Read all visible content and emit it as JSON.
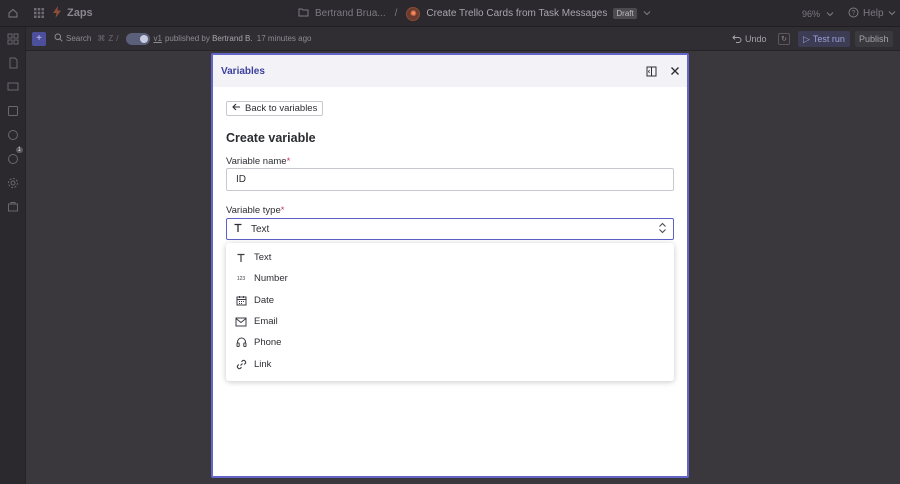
{
  "topbar": {
    "brand": "Zaps",
    "folder": "Bertrand Brua...",
    "separator": "/",
    "zap_name": "Create Trello Cards from Task Messages",
    "status_badge": "Draft",
    "zoom": "96%",
    "help": "Help"
  },
  "toolbar": {
    "search_label": "Search",
    "shortcut_keys": [
      "⌘",
      "Z",
      "/"
    ],
    "version": "v1",
    "published_prefix": "published by",
    "published_by": "Bertrand B.",
    "published_time": "17 minutes ago",
    "undo": "Undo",
    "test_run": "Test run",
    "publish": "Publish"
  },
  "sidebar": {
    "badge_count": "1"
  },
  "modal": {
    "title": "Variables",
    "back_button": "Back to variables",
    "heading": "Create variable",
    "name_label": "Variable name",
    "name_value": "ID",
    "type_label": "Variable type",
    "required_mark": "*",
    "type_selected": "Text",
    "options": [
      {
        "label": "Text",
        "icon": "text-icon"
      },
      {
        "label": "Number",
        "icon": "number-icon"
      },
      {
        "label": "Date",
        "icon": "calendar-icon"
      },
      {
        "label": "Email",
        "icon": "email-icon"
      },
      {
        "label": "Phone",
        "icon": "phone-icon"
      },
      {
        "label": "Link",
        "icon": "link-icon"
      }
    ]
  },
  "colors": {
    "accent": "#6466c7",
    "required": "#d0385b",
    "brand_orange": "#ff4f00"
  }
}
